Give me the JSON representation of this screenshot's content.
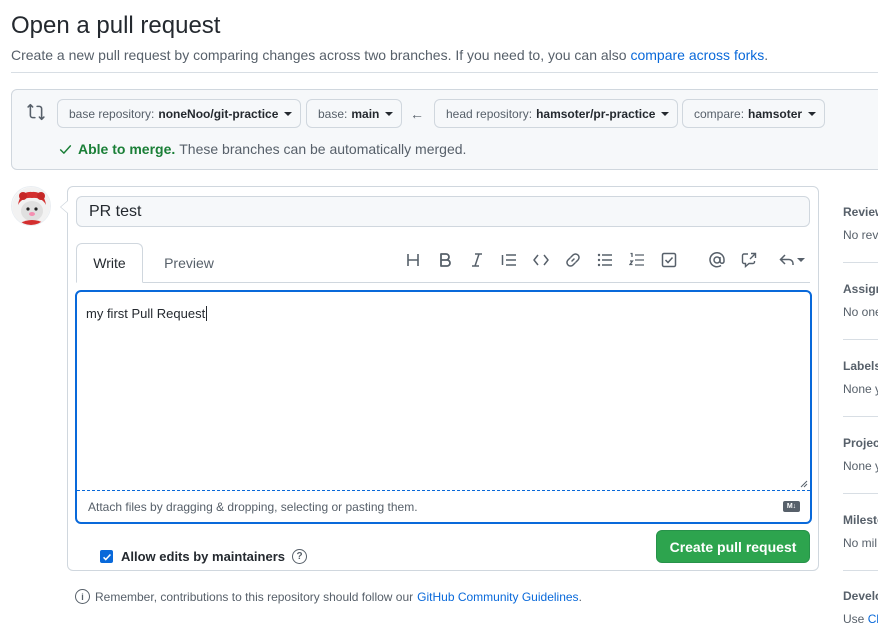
{
  "header": {
    "title": "Open a pull request",
    "subtitle": "Create a new pull request by comparing changes across two branches. If you need to, you can also",
    "subtitle_link": "compare across forks",
    "subtitle_end": "."
  },
  "range": {
    "base_repo_prefix": "base repository:",
    "base_repo": "noneNoo/git-practice",
    "base_prefix": "base:",
    "base": "main",
    "arrow": "←",
    "head_repo_prefix": "head repository:",
    "head_repo": "hamsoter/pr-practice",
    "compare_prefix": "compare:",
    "compare": "hamsoter",
    "merge_ok": "Able to merge.",
    "merge_msg": "These branches can be automatically merged."
  },
  "composer": {
    "title_value": "PR test",
    "tabs": [
      {
        "label": "Write",
        "active": true
      },
      {
        "label": "Preview",
        "active": false
      }
    ],
    "toolbar": [
      "heading-icon",
      "bold-icon",
      "italic-icon",
      "quote-icon",
      "code-icon",
      "link-icon",
      "bulleted-list-icon",
      "numbered-list-icon",
      "task-list-icon",
      "mention-icon",
      "reference-icon",
      "reply-icon"
    ],
    "body_value": "my first Pull Request",
    "attach_text": "Attach files by dragging & dropping, selecting or pasting them.",
    "markdown_badge": "M↓",
    "allow_edits_label": "Allow edits by maintainers",
    "allow_edits_checked": true,
    "help_glyph": "?",
    "create_label": "Create pull request"
  },
  "footer": {
    "info_glyph": "i",
    "text": "Remember, contributions to this repository should follow our",
    "link": "GitHub Community Guidelines",
    "end": "."
  },
  "sidebar": {
    "sections": [
      {
        "heading": "Review",
        "value": "No rev"
      },
      {
        "heading": "Assign",
        "value": "No one"
      },
      {
        "heading": "Labels",
        "value": "None y"
      },
      {
        "heading": "Project",
        "value": "None y"
      },
      {
        "heading": "Milesto",
        "value": "No mil"
      },
      {
        "heading": "Develo",
        "value_prefix": "Use ",
        "value_link": "Cl"
      }
    ]
  },
  "colors": {
    "accent": "#0969da",
    "success": "#1a7f37",
    "primary_button": "#2da44e"
  }
}
